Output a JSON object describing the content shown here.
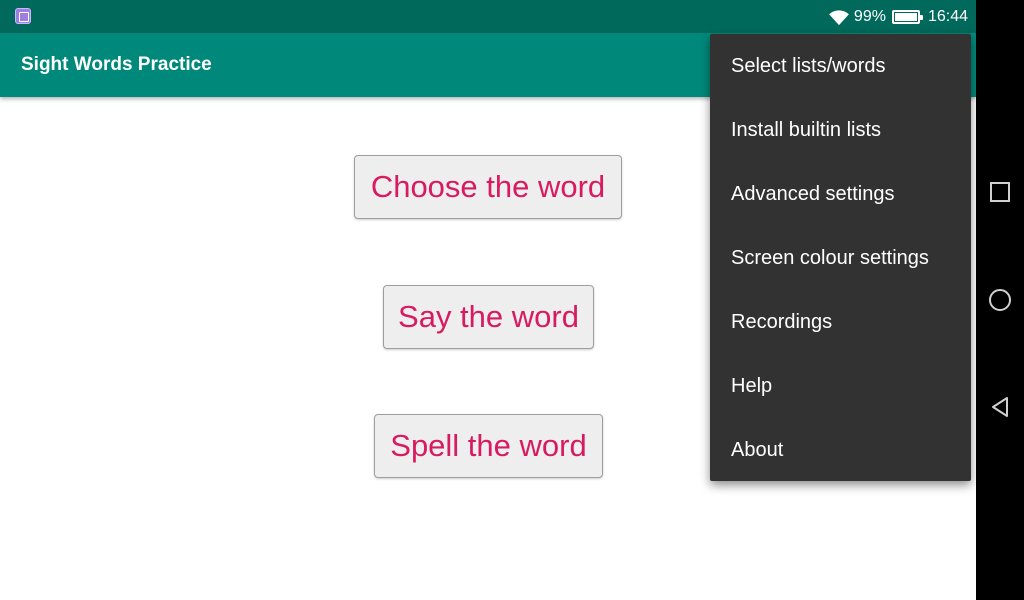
{
  "status_bar": {
    "battery_percent": "99%",
    "battery_level": 0.99,
    "time": "16:44",
    "icons": {
      "notification": "image-icon",
      "wifi": "wifi-icon",
      "battery": "battery-icon"
    }
  },
  "app_bar": {
    "title": "Sight Words Practice"
  },
  "main": {
    "buttons": [
      {
        "label": "Choose the word"
      },
      {
        "label": "Say the word"
      },
      {
        "label": "Spell the word"
      }
    ]
  },
  "menu": {
    "items": [
      {
        "label": "Select lists/words"
      },
      {
        "label": "Install builtin lists"
      },
      {
        "label": "Advanced settings"
      },
      {
        "label": "Screen colour settings"
      },
      {
        "label": "Recordings"
      },
      {
        "label": "Help"
      },
      {
        "label": "About"
      }
    ]
  },
  "nav_bar": {
    "icons": [
      "recents-icon",
      "home-icon",
      "back-icon"
    ]
  },
  "colors": {
    "status_bar": "#00695c",
    "app_bar": "#00897b",
    "button_text": "#d81b60",
    "button_bg": "#eeeeee",
    "menu_bg": "#323232"
  }
}
